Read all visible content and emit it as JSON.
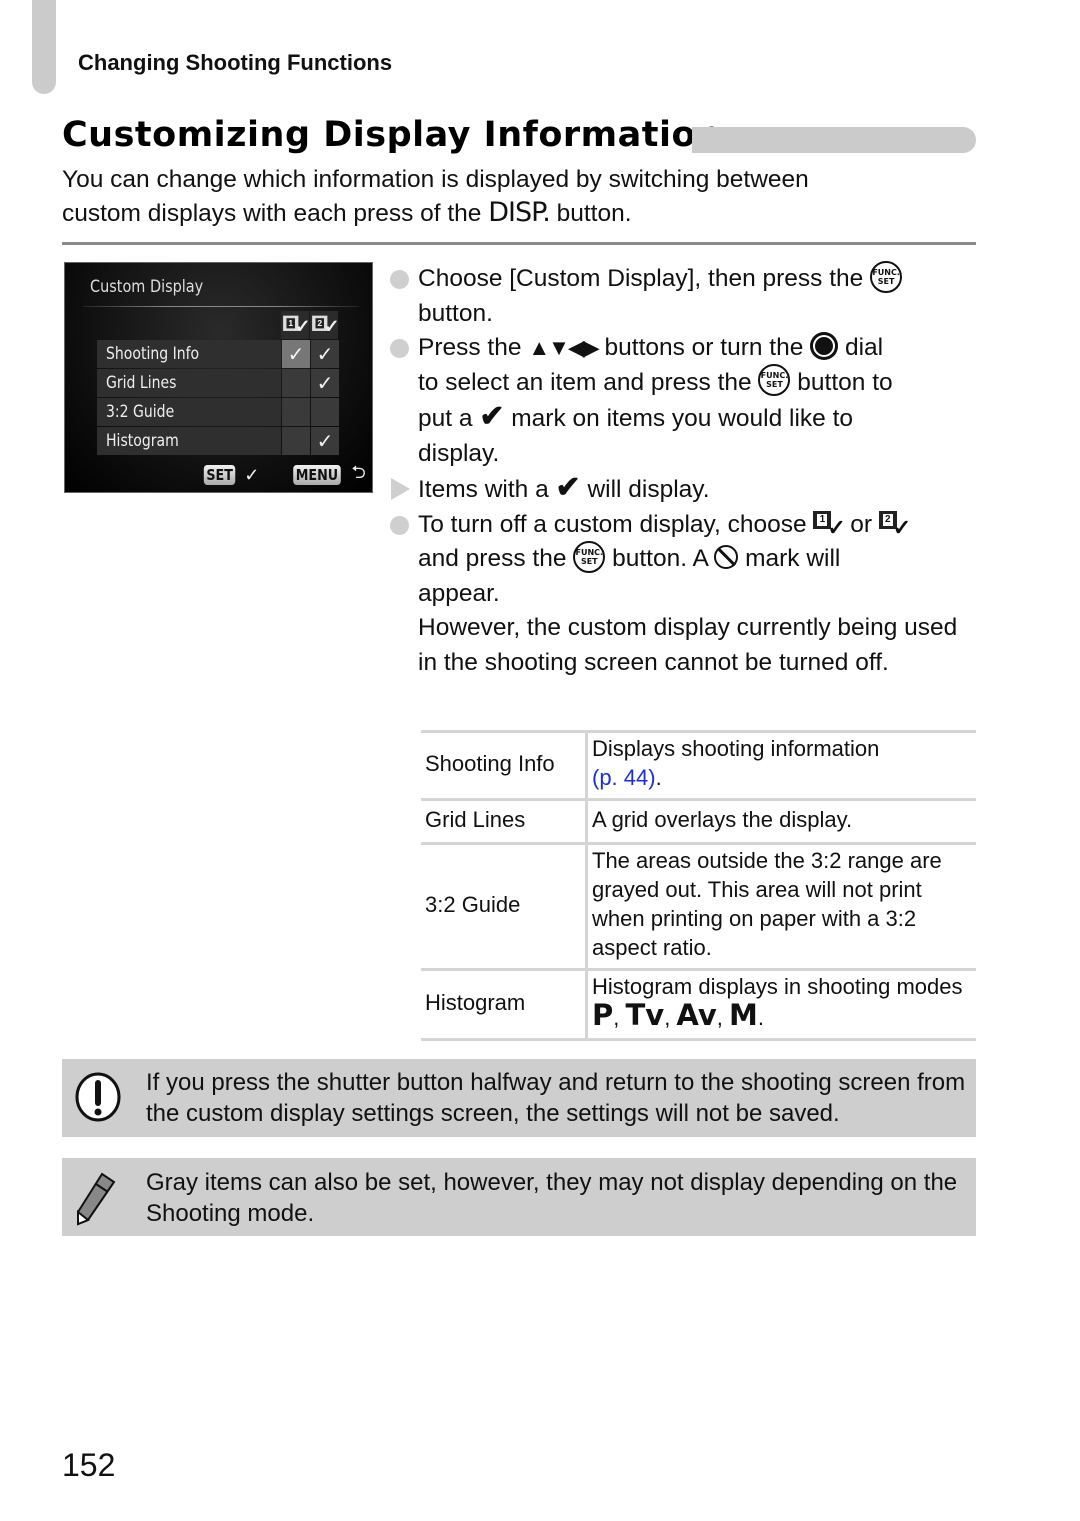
{
  "header": {
    "section": "Changing Shooting Functions",
    "title": "Customizing Display Information"
  },
  "intro": {
    "line1": "You can change which information is displayed by switching between",
    "line2_pre": "custom displays with each press of the ",
    "disp_button": "DISP.",
    "line2_post": " button."
  },
  "camera_screen": {
    "title": "Custom Display",
    "columns": [
      "1",
      "2"
    ],
    "rows": [
      {
        "label": "Shooting Info",
        "c1": "✓",
        "c2": "✓"
      },
      {
        "label": "Grid Lines",
        "c1": "",
        "c2": "✓"
      },
      {
        "label": "3:2 Guide",
        "c1": "",
        "c2": ""
      },
      {
        "label": "Histogram",
        "c1": "",
        "c2": "✓"
      }
    ],
    "footer": {
      "set_key": "SET",
      "set_action": "✓",
      "menu_key": "MENU",
      "menu_action": "⮌"
    }
  },
  "steps": {
    "s1_a": "Choose [Custom Display], then press the ",
    "s1_b": "button.",
    "s2_a": "Press the ",
    "s2_arrows": "▲▼◀▶",
    "s2_b": " buttons or turn the ",
    "s2_c": " dial",
    "s2_d": "to select an item and press the ",
    "s2_e": " button to",
    "s2_f": "put a ",
    "s2_check": "✔",
    "s2_g": " mark on items you would like to",
    "s2_h": "display.",
    "s3_a": "Items with a ",
    "s3_check": "✔",
    "s3_b": " will display.",
    "s4_a": "To turn off a custom display, choose ",
    "s4_or": " or ",
    "s4_b": "and press the ",
    "s4_c": " button. A ",
    "s4_d": " mark will",
    "s4_e": "appear.",
    "s4_note": "However, the custom display currently being used in the shooting screen cannot be turned off.",
    "func_top": "FUNC.",
    "func_bottom": "SET"
  },
  "table": {
    "rows": [
      {
        "name": "Shooting Info",
        "desc": "Displays shooting information ",
        "link": "(p. 44)",
        "desc_end": "."
      },
      {
        "name": "Grid Lines",
        "desc": "A grid overlays the display."
      },
      {
        "name": "3:2 Guide",
        "desc": "The areas outside the 3:2 range are grayed out. This area will not print when printing on paper with a 3:2 aspect ratio."
      },
      {
        "name": "Histogram",
        "desc": "Histogram displays in shooting modes ",
        "modes": [
          "P",
          "Tv",
          "Av",
          "M"
        ]
      }
    ]
  },
  "notes": {
    "caution": "If you press the shutter button halfway and return to the shooting screen from the custom display settings screen, the settings will not be saved.",
    "memo": "Gray items can also be set, however, they may not display depending on the Shooting mode."
  },
  "page_number": "152",
  "colors": {
    "link": "#1a2fd8",
    "note_bg": "#cecece",
    "accent_gray": "#cbcbcb"
  }
}
